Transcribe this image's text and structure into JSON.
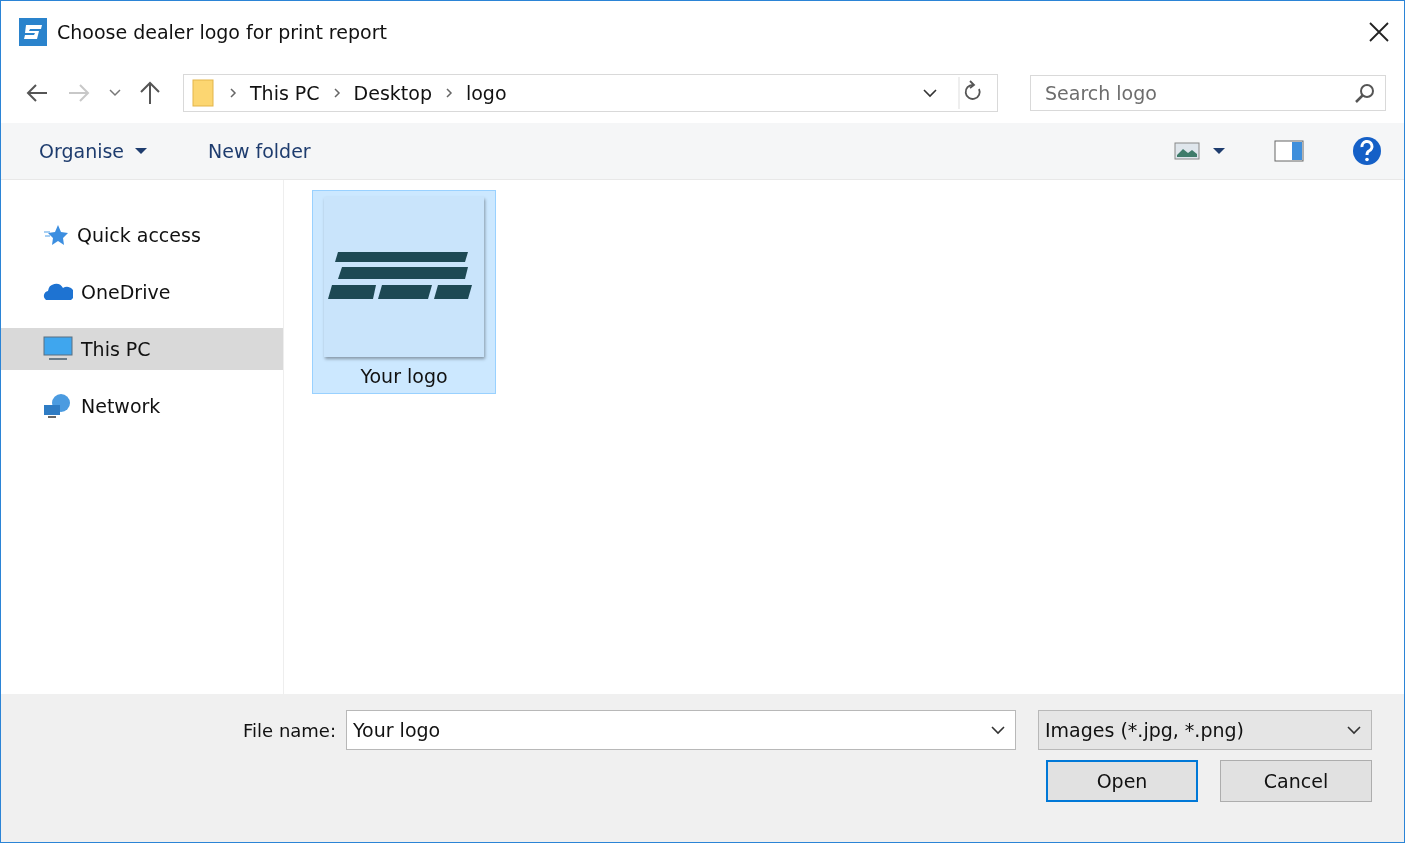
{
  "window": {
    "title": "Choose dealer logo for print report"
  },
  "address_bar": {
    "path": [
      "This PC",
      "Desktop",
      "logo"
    ]
  },
  "search": {
    "placeholder": "Search logo"
  },
  "toolbar": {
    "items": [
      "Organise",
      "New folder"
    ]
  },
  "sidebar": {
    "items": [
      {
        "label": "Quick access",
        "kind": "star",
        "selected": false
      },
      {
        "label": "OneDrive",
        "kind": "cloud",
        "selected": false
      },
      {
        "label": "This PC",
        "kind": "pc",
        "selected": true
      },
      {
        "label": "Network",
        "kind": "network",
        "selected": false
      }
    ]
  },
  "files": [
    {
      "name": "Your logo",
      "kind": "picture",
      "selected": true
    }
  ],
  "file_name": {
    "label": "File name:",
    "value": "Your logo"
  },
  "file_type": {
    "value": "Images (*.jpg, *.png)"
  },
  "buttons": [
    {
      "label": "Open",
      "selected": true
    },
    {
      "label": "Cancel",
      "selected": false
    }
  ]
}
